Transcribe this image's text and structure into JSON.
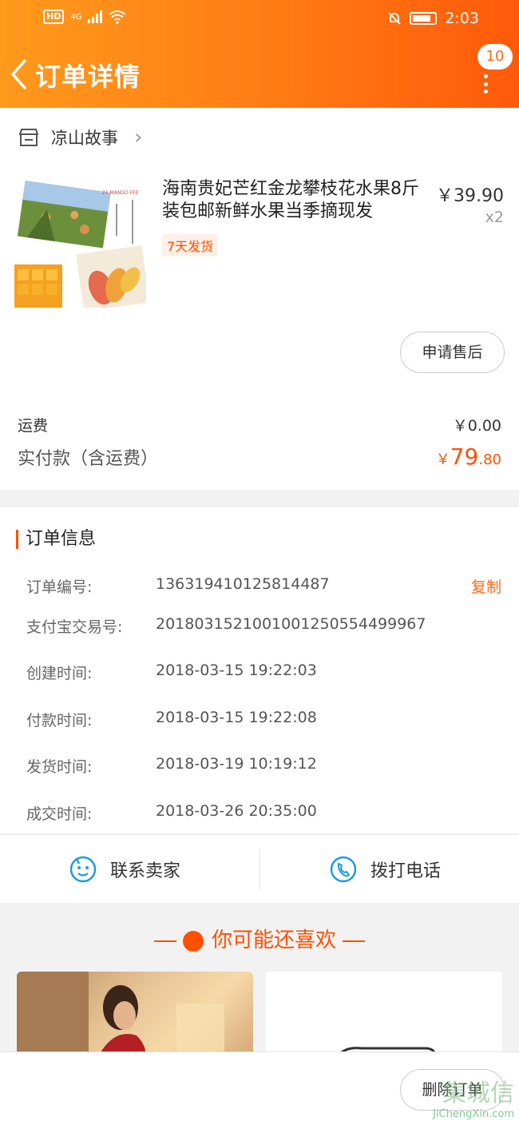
{
  "status": {
    "time": "2:03",
    "hd": "HD",
    "net": "4G"
  },
  "header": {
    "title": "订单详情",
    "badge": "10"
  },
  "shop": {
    "name": "凉山故事"
  },
  "product": {
    "name": "海南贵妃芒红金龙攀枝花水果8斤装包邮新鲜水果当季摘现发",
    "tag": "7天发货",
    "price": "￥39.90",
    "qty": "x2",
    "after_sale": "申请售后"
  },
  "fees": {
    "shipping_label": "运费",
    "shipping_value": "￥0.00",
    "paid_label": "实付款（含运费）",
    "paid_symbol": "￥",
    "paid_int": "79",
    "paid_dec": ".80"
  },
  "order_info": {
    "title": "订单信息",
    "copy": "复制",
    "rows": [
      {
        "k": "订单编号:",
        "v": "136319410125814487"
      },
      {
        "k": "支付宝交易号:",
        "v": "2018031521001001250554499967"
      },
      {
        "k": "创建时间:",
        "v": "2018-03-15 19:22:03"
      },
      {
        "k": "付款时间:",
        "v": "2018-03-15 19:22:08"
      },
      {
        "k": "发货时间:",
        "v": "2018-03-19 10:19:12"
      },
      {
        "k": "成交时间:",
        "v": "2018-03-26 20:35:00"
      }
    ]
  },
  "contact": {
    "seller": "联系卖家",
    "phone": "拨打电话"
  },
  "recommend": {
    "title": "你可能还喜欢"
  },
  "bottom": {
    "delete": "删除订单",
    "watermark_cn": "集城信",
    "watermark_en": "JiChengXin.com"
  },
  "colors": {
    "accent": "#ff5000",
    "header_start": "#ff9a1c",
    "header_end": "#ff5a0a",
    "icon_blue": "#1e9be0"
  }
}
